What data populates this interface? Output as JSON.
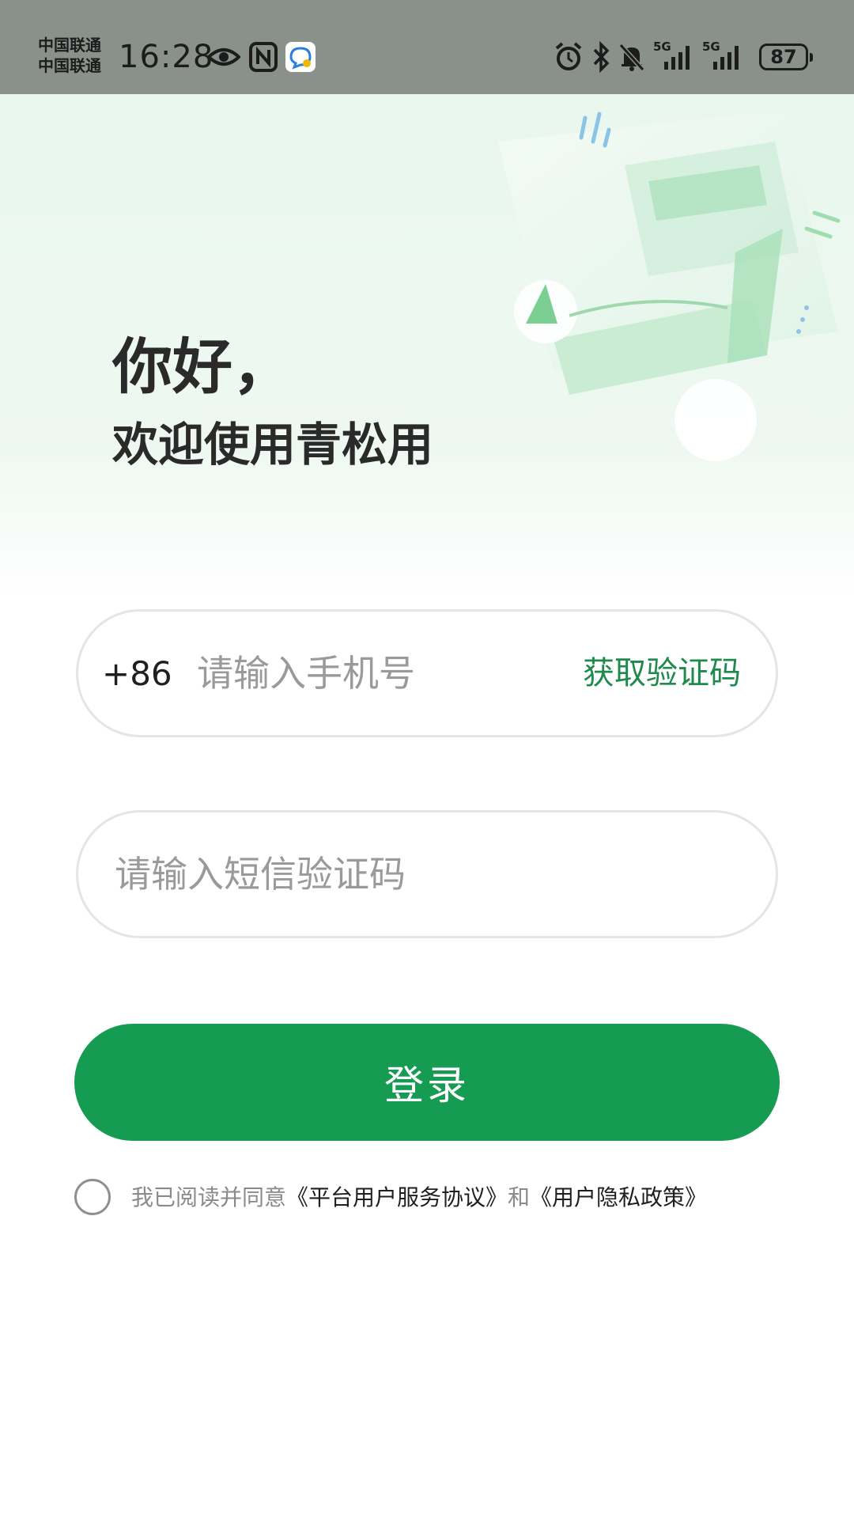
{
  "status_bar": {
    "carrier_1": "中国联通",
    "carrier_2": "中国联通",
    "time": "16:28",
    "network_1": "5G",
    "network_2": "5G",
    "battery": "87",
    "icons": [
      "eye-icon",
      "nfc-icon",
      "chat-app-icon",
      "alarm-icon",
      "bluetooth-icon",
      "mute-icon",
      "signal-icon",
      "signal-icon",
      "battery-icon"
    ]
  },
  "hero": {
    "greeting": "你好，",
    "welcome": "欢迎使用青松用"
  },
  "phone": {
    "country_code": "+86",
    "placeholder": "请输入手机号",
    "get_code_label": "获取验证码"
  },
  "sms_code": {
    "placeholder": "请输入短信验证码"
  },
  "login": {
    "label": "登录"
  },
  "agreement": {
    "prefix": "我已阅读并同意",
    "terms_link": "《平台用户服务协议》",
    "conjunction": "和",
    "privacy_link": "《用户隐私政策》"
  },
  "colors": {
    "primary": "#169b52",
    "link_green": "#1f8a4c",
    "status_bar": "#8a918b"
  }
}
